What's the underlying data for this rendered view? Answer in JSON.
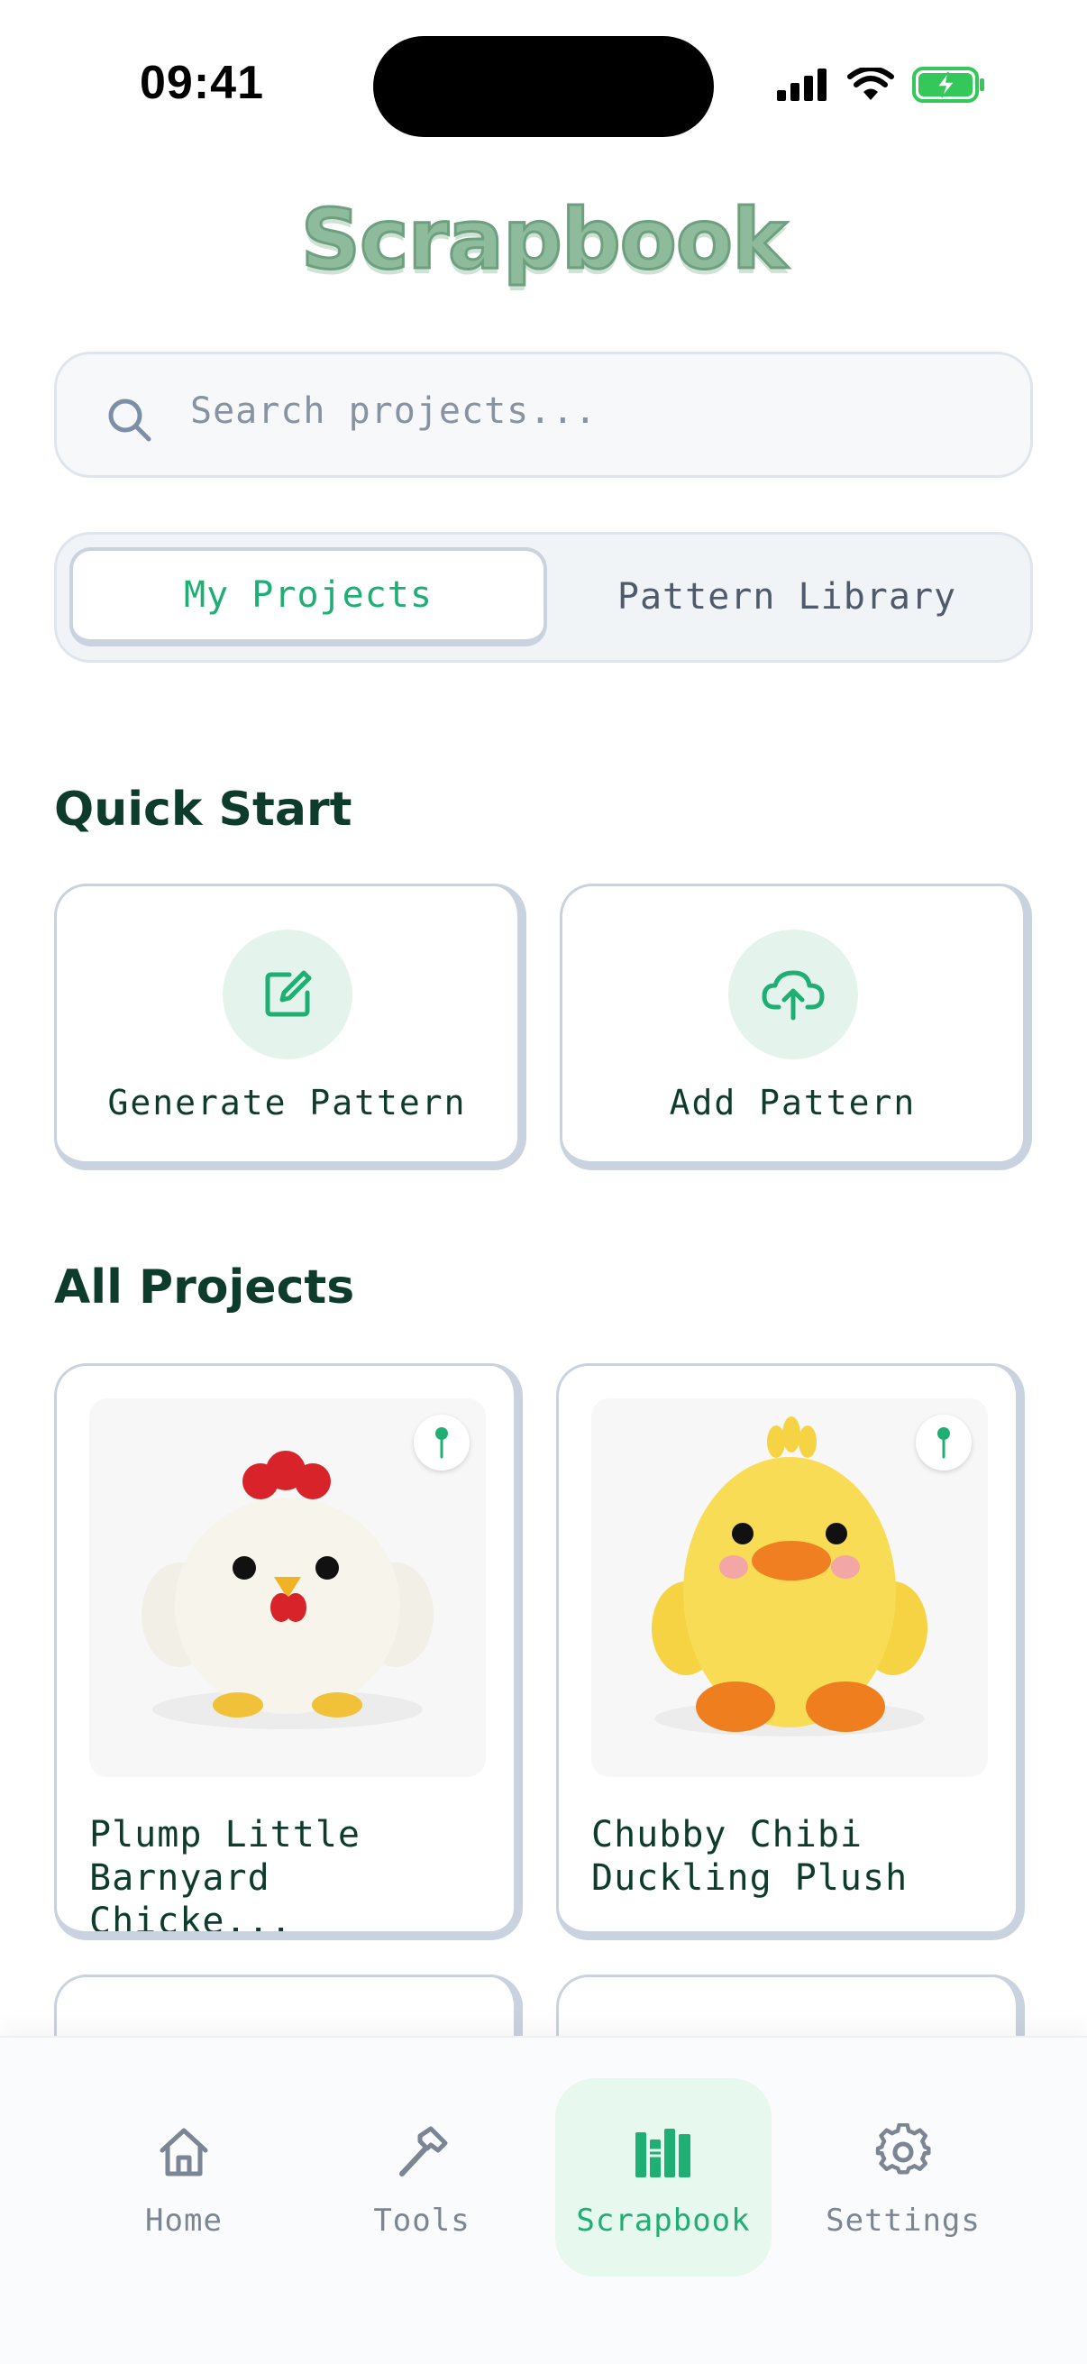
{
  "status_bar": {
    "time": "09:41"
  },
  "app": {
    "title": "Scrapbook"
  },
  "search": {
    "placeholder": "Search projects..."
  },
  "segmented": {
    "tabs": [
      {
        "label": "My Projects",
        "active": true
      },
      {
        "label": "Pattern Library",
        "active": false
      }
    ]
  },
  "quick_start": {
    "heading": "Quick Start",
    "cards": [
      {
        "label": "Generate Pattern",
        "icon": "edit-icon"
      },
      {
        "label": "Add Pattern",
        "icon": "cloud-upload-icon"
      }
    ]
  },
  "all_projects": {
    "heading": "All Projects",
    "items": [
      {
        "title": "Plump Little\nBarnyard Chicke...",
        "image": "crochet-chicken",
        "pinned": true
      },
      {
        "title": "Chubby Chibi\nDuckling Plush",
        "image": "crochet-duckling",
        "pinned": true
      }
    ]
  },
  "bottom_nav": {
    "items": [
      {
        "label": "Home",
        "icon": "home-icon",
        "active": false
      },
      {
        "label": "Tools",
        "icon": "hammer-icon",
        "active": false
      },
      {
        "label": "Scrapbook",
        "icon": "books-icon",
        "active": true
      },
      {
        "label": "Settings",
        "icon": "gear-icon",
        "active": false
      }
    ]
  },
  "colors": {
    "accent": "#1fae73",
    "title": "#8dbb9b",
    "heading": "#0d3b2c",
    "active_bg": "#e7f8ee"
  }
}
